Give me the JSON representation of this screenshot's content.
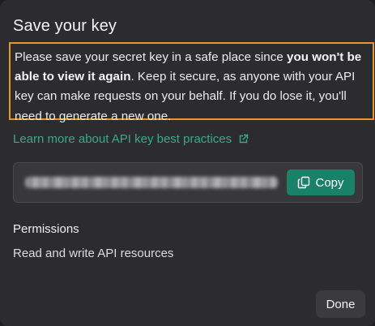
{
  "dialog": {
    "title": "Save your key",
    "warning": {
      "text_start": "Please save your secret key in a safe place since ",
      "text_bold": "you won't be able to view it again",
      "text_end": ". Keep it secure, as anyone with your API key can make requests on your behalf. If you do lose it, you'll need to generate a new one."
    },
    "learn_link": {
      "label": "Learn more about API key best practices",
      "icon": "external-link-icon"
    },
    "key_field": {
      "value_state": "blurred",
      "copy_label": "Copy",
      "copy_icon": "copy-icon"
    },
    "permissions": {
      "label": "Permissions",
      "value": "Read and write API resources"
    },
    "done_label": "Done"
  },
  "colors": {
    "background": "#2c2c2f",
    "highlight_border": "#e9952c",
    "link": "#3aa986",
    "primary_button": "#198168",
    "secondary_button": "#3b3b3f"
  }
}
